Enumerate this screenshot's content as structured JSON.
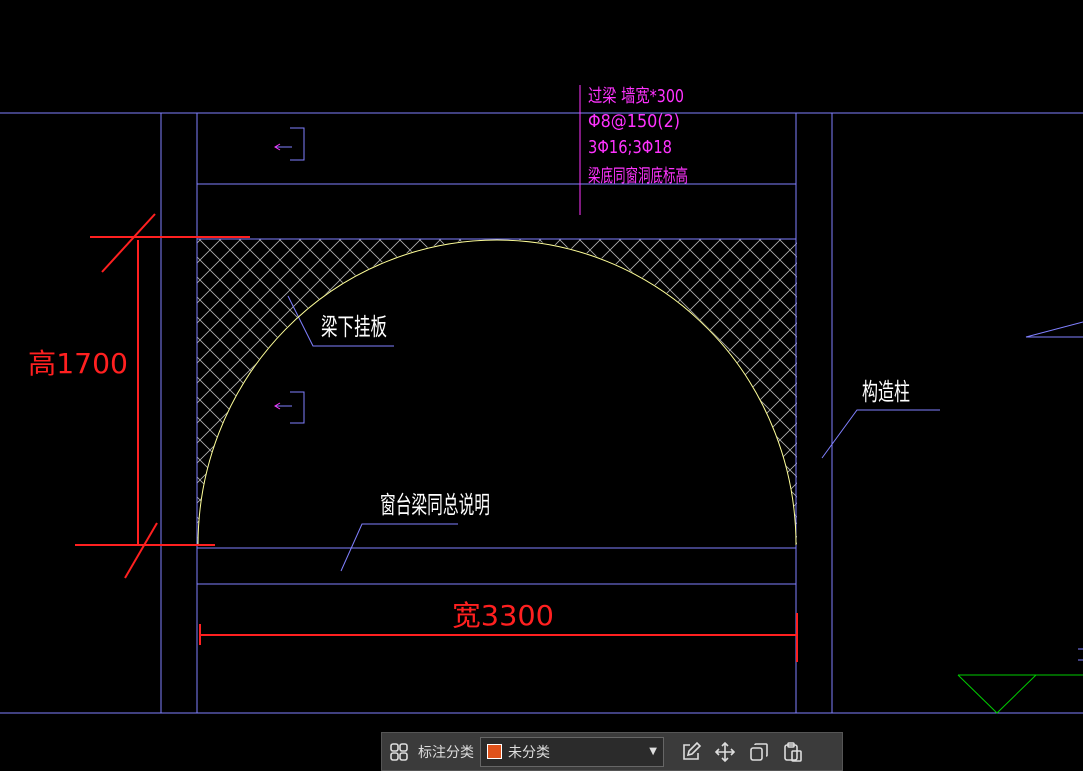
{
  "annotations": {
    "beam_lines": [
      "过梁 墙宽*300",
      "Φ8@150(2)",
      "3Φ16;3Φ18",
      "梁底同窗洞底标高"
    ],
    "hanging_board": "梁下挂板",
    "column": "构造柱",
    "sill_beam": "窗台梁同总说明",
    "height_dim": "高1700",
    "width_dim": "宽3300"
  },
  "toolbar": {
    "category_label": "标注分类",
    "selected_category": "未分类",
    "swatch_color": "#e0521b"
  },
  "colors": {
    "grid_line": "#8080ff",
    "magenta": "#ff33ff",
    "red": "#ff2020",
    "arc": "#ffff99",
    "hatch": "#bfbfbf",
    "green": "#00cc00"
  }
}
